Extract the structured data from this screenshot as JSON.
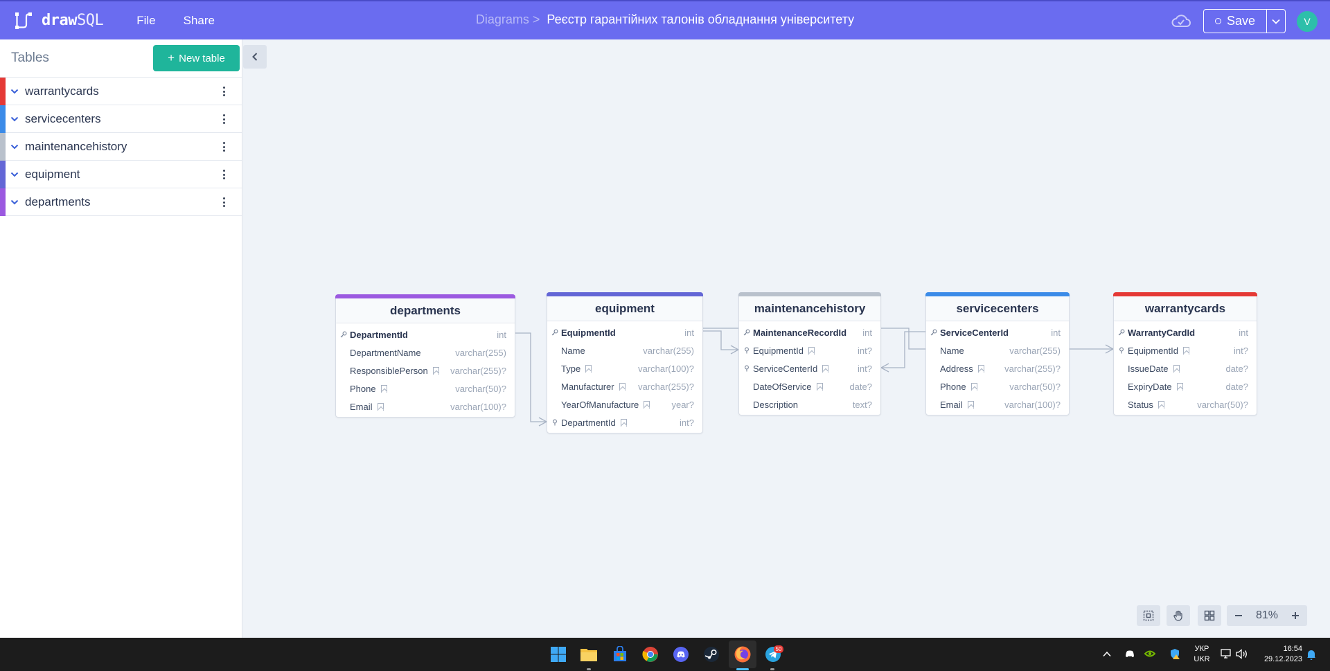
{
  "app": {
    "logo_bold": "draw",
    "logo_thin": "SQL",
    "menu": [
      "File",
      "Share"
    ],
    "breadcrumb": "Diagrams >",
    "diagram_title": "Реєстр гарантійних талонів обладнання університету",
    "save_label": "Save",
    "avatar_letter": "V"
  },
  "sidebar": {
    "title": "Tables",
    "new_table_label": "New table",
    "items": [
      {
        "label": "warrantycards",
        "color": "#e53935"
      },
      {
        "label": "servicecenters",
        "color": "#3b8be8"
      },
      {
        "label": "maintenancehistory",
        "color": "#b9c1cc"
      },
      {
        "label": "equipment",
        "color": "#6366d6"
      },
      {
        "label": "departments",
        "color": "#9b59e0"
      }
    ]
  },
  "tables": {
    "departments": {
      "title": "departments",
      "color": "#9b59e0",
      "fields": [
        {
          "name": "DepartmentId",
          "type": "int"
        },
        {
          "name": "DepartmentName",
          "type": "varchar(255)"
        },
        {
          "name": "ResponsiblePerson",
          "type": "varchar(255)?"
        },
        {
          "name": "Phone",
          "type": "varchar(50)?"
        },
        {
          "name": "Email",
          "type": "varchar(100)?"
        }
      ]
    },
    "equipment": {
      "title": "equipment",
      "color": "#6366d6",
      "fields": [
        {
          "name": "EquipmentId",
          "type": "int"
        },
        {
          "name": "Name",
          "type": "varchar(255)"
        },
        {
          "name": "Type",
          "type": "varchar(100)?"
        },
        {
          "name": "Manufacturer",
          "type": "varchar(255)?"
        },
        {
          "name": "YearOfManufacture",
          "type": "year?"
        },
        {
          "name": "DepartmentId",
          "type": "int?"
        }
      ]
    },
    "maintenancehistory": {
      "title": "maintenancehistory",
      "color": "#b9c1cc",
      "fields": [
        {
          "name": "MaintenanceRecordId",
          "type": "int"
        },
        {
          "name": "EquipmentId",
          "type": "int?"
        },
        {
          "name": "ServiceCenterId",
          "type": "int?"
        },
        {
          "name": "DateOfService",
          "type": "date?"
        },
        {
          "name": "Description",
          "type": "text?"
        }
      ]
    },
    "servicecenters": {
      "title": "servicecenters",
      "color": "#3b8be8",
      "fields": [
        {
          "name": "ServiceCenterId",
          "type": "int"
        },
        {
          "name": "Name",
          "type": "varchar(255)"
        },
        {
          "name": "Address",
          "type": "varchar(255)?"
        },
        {
          "name": "Phone",
          "type": "varchar(50)?"
        },
        {
          "name": "Email",
          "type": "varchar(100)?"
        }
      ]
    },
    "warrantycards": {
      "title": "warrantycards",
      "color": "#e53935",
      "fields": [
        {
          "name": "WarrantyCardId",
          "type": "int"
        },
        {
          "name": "EquipmentId",
          "type": "int?"
        },
        {
          "name": "IssueDate",
          "type": "date?"
        },
        {
          "name": "ExpiryDate",
          "type": "date?"
        },
        {
          "name": "Status",
          "type": "varchar(50)?"
        }
      ]
    }
  },
  "zoom": {
    "level": "81%"
  },
  "taskbar": {
    "lang_top": "УКР",
    "lang_bottom": "UKR",
    "time": "16:54",
    "date": "29.12.2023",
    "telegram_badge": "50"
  }
}
